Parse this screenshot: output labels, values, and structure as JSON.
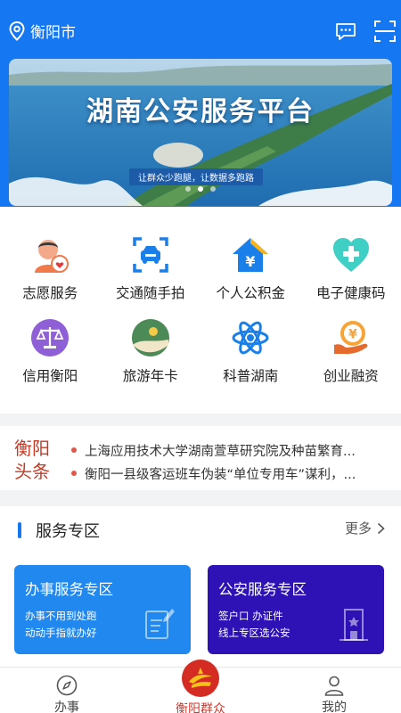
{
  "header": {
    "city": "衡阳市"
  },
  "banner": {
    "title": "湖南公安服务平台",
    "slogan": "让群众少跑腿，让数据多跑路",
    "dots": 3,
    "active_dot": 1
  },
  "services": [
    {
      "label": "志愿服务",
      "icon": "volunteer-icon"
    },
    {
      "label": "交通随手拍",
      "icon": "traffic-camera-icon"
    },
    {
      "label": "个人公积金",
      "icon": "housing-fund-icon"
    },
    {
      "label": "电子健康码",
      "icon": "health-code-icon"
    },
    {
      "label": "信用衡阳",
      "icon": "credit-scale-icon"
    },
    {
      "label": "旅游年卡",
      "icon": "travel-card-icon"
    },
    {
      "label": "科普湖南",
      "icon": "science-atom-icon"
    },
    {
      "label": "创业融资",
      "icon": "finance-yuan-icon"
    }
  ],
  "news": {
    "brand_line1": "衡阳",
    "brand_line2": "头条",
    "items": [
      "上海应用技术大学湖南萱草研究院及种苗繁育...",
      "衡阳一县级客运班车伪装“单位专用车”谋利，..."
    ]
  },
  "zone": {
    "title": "服务专区",
    "more": "更多",
    "cards": [
      {
        "title": "办事服务专区",
        "line1": "办事不用到处跑",
        "line2": "动动手指就办好"
      },
      {
        "title": "公安服务专区",
        "line1": "签户口 办证件",
        "line2": "线上专区选公安"
      }
    ]
  },
  "tabs": [
    {
      "label": "办事",
      "icon": "compass-icon"
    },
    {
      "label": "衡阳群众",
      "icon": "hengyang-logo-icon"
    },
    {
      "label": "我的",
      "icon": "user-icon"
    }
  ],
  "colors": {
    "primary": "#1677f2",
    "accent_red": "#d4382c",
    "card_blue": "#2188ef",
    "card_purple": "#2f12b5"
  }
}
